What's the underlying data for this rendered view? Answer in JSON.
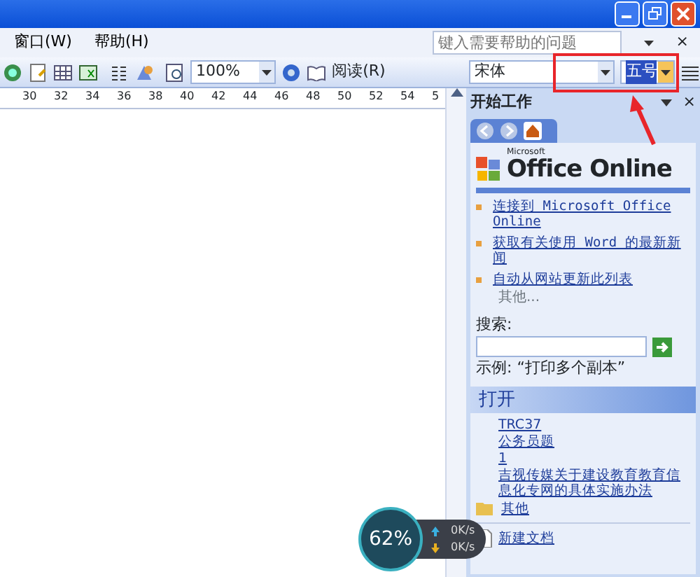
{
  "menu": [
    "窗口(W)",
    "帮助(H)"
  ],
  "help_search": {
    "placeholder": "键入需要帮助的问题",
    "close": "×"
  },
  "toolbar": {
    "zoom": "100%",
    "read_button": "阅读(R)",
    "font": "宋体",
    "font_size": "五号"
  },
  "ruler": [
    "30",
    "32",
    "34",
    "36",
    "38",
    "40",
    "42",
    "44",
    "46",
    "48",
    "50",
    "52",
    "54",
    "5"
  ],
  "task_pane": {
    "title": "开始工作",
    "close": "×",
    "logo_small": "Microsoft",
    "logo": "Office Online",
    "links": [
      "连接到 Microsoft Office Online",
      "获取有关使用 Word 的最新新闻",
      "自动从网站更新此列表"
    ],
    "more": "其他...",
    "search_label": "搜索:",
    "example": "示例:  “打印多个副本”",
    "open_title": "打开",
    "files": [
      "TRC37",
      "公务员题",
      "1",
      "吉视传媒关于建设教育教育信息化专网的具体实施办法"
    ],
    "other": "其他",
    "new_doc": "新建文档"
  },
  "network": {
    "percent": "62%",
    "up": "0K/s",
    "down": "0K/s"
  }
}
